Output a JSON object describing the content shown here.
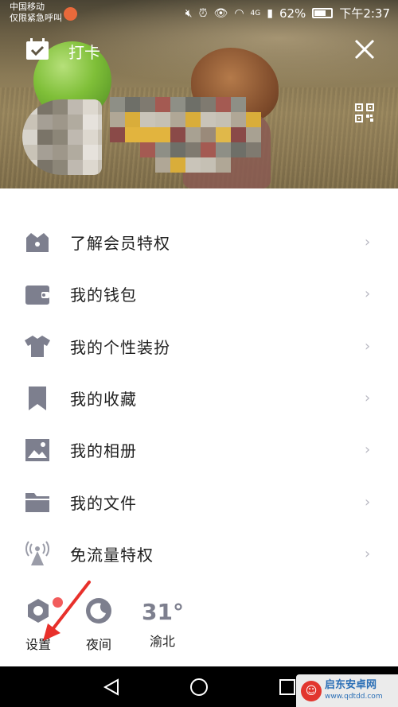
{
  "status_bar": {
    "carrier_line1": "中国移动",
    "carrier_line2": "仅限紧急呼叫",
    "network": "4G",
    "battery": "62%",
    "time": "下午2:37"
  },
  "header": {
    "checkin_label": "打卡",
    "icons": [
      "calendar-check-icon",
      "close-icon",
      "qr-code-icon"
    ]
  },
  "menu": {
    "items": [
      {
        "label": "了解会员特权",
        "icon": "member-crown-icon"
      },
      {
        "label": "我的钱包",
        "icon": "wallet-icon"
      },
      {
        "label": "我的个性装扮",
        "icon": "shirt-icon"
      },
      {
        "label": "我的收藏",
        "icon": "bookmark-icon"
      },
      {
        "label": "我的相册",
        "icon": "photo-icon"
      },
      {
        "label": "我的文件",
        "icon": "folder-icon"
      },
      {
        "label": "免流量特权",
        "icon": "signal-tower-icon"
      }
    ],
    "arrow": "›"
  },
  "quick": {
    "settings_label": "设置",
    "night_label": "夜间",
    "temperature": "31°",
    "city": "渝北"
  },
  "watermark": {
    "title": "启东安卓网",
    "url": "www.qdtdd.com"
  },
  "colors": {
    "icon_gray": "#7d7f8e",
    "arrow_gray": "#b9b9c3",
    "badge_red": "#f25c5c",
    "annotation_red": "#e8302b"
  }
}
